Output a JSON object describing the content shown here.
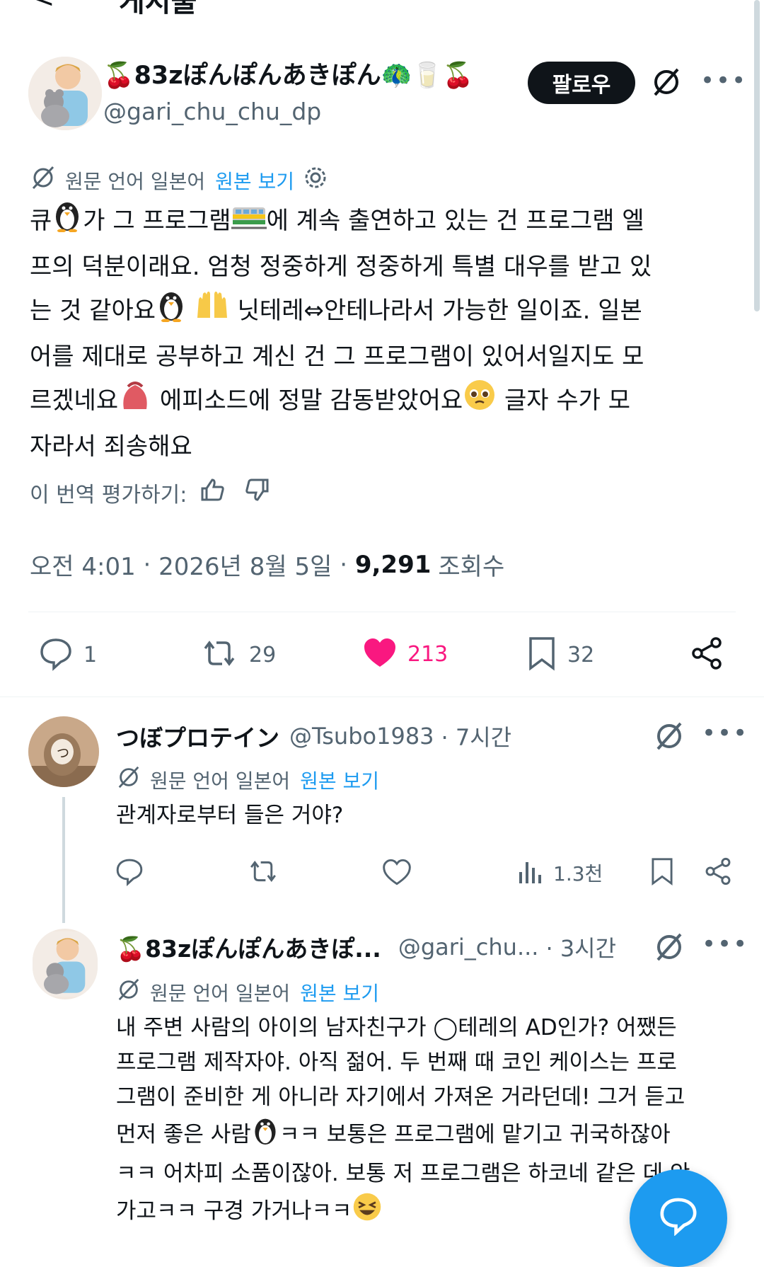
{
  "header": {
    "back_glyph": "<",
    "title": "게시물"
  },
  "main_post": {
    "author": {
      "display_name": "🍒83zぽんぽんあきぽん🦚🥛🍒",
      "handle": "@gari_chu_chu_dp"
    },
    "follow_label": "팔로우",
    "translation_note": "원문 언어 일본어",
    "show_original": "원본 보기",
    "text": {
      "p1": "큐",
      "p2": "가 그 프로그램",
      "p3": "에 계속 출연하고 있는 건 프로그램 엘\n프의 덕분이래요. 엄청 정중하게 정중하게 특별 대우를 받고 있\n는 것 같아요",
      "p4": " ",
      "p5": " 닛테레⇔안테나라서 가능한 일이죠. 일본\n어를 제대로 공부하고 계신 건 그 프로그램이 있어서일지도 모\n르겠네요",
      "p6": " 에피소드에 정말 감동받았어요",
      "p7": " 글자 수가 모\n자라서 죄송해요"
    },
    "rate_translation": "이 번역 평가하기:",
    "time": "오전 4:01",
    "date": "2026년 8월 5일",
    "views_count": "9,291",
    "views_label": "조회수",
    "actions": {
      "replies": "1",
      "reposts": "29",
      "likes": "213",
      "bookmarks": "32"
    }
  },
  "replies": [
    {
      "display_name": "つぼプロテイン",
      "handle": "@Tsubo1983",
      "time": "· 7시간",
      "translation_note": "원문 언어 일본어",
      "show_original": "원본 보기",
      "text": "관계자로부터 들은 거야?",
      "views": "1.3천"
    },
    {
      "display_name": "🍒83zぽんぽんあきぽ...",
      "handle": "@gari_chu...",
      "time": "· 3시간",
      "translation_note": "원문 언어 일본어",
      "show_original": "원본 보기",
      "text_a": "내 주변 사람의 아이의 남자친구가 ◯테레의 AD인가? 어쨌든\n프로그램 제작자야. 아직 젊어. 두 번째 때 코인 케이스는 프로\n그램이 준비한 게 아니라 자기에서 가져온 거라던데! 그거 듣고\n먼저 좋은 사람",
      "text_b": "ㅋㅋ 보통은 프로그램에 맡기고 귀국하잖아\nㅋㅋ 어차피 소품이잖아. 보통 저 프로그램은 하코네 같은 데 안\n가고ㅋㅋ 구경 가거나ㅋㅋ"
    }
  ],
  "colors": {
    "accent": "#1d9bf0",
    "like": "#f91880",
    "text": "#0f1419",
    "muted": "#536471"
  }
}
